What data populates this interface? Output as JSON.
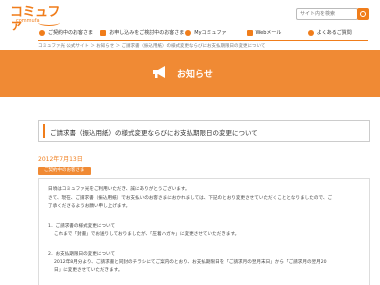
{
  "logo": {
    "name": "コミュファ",
    "tagline": "commufa"
  },
  "search": {
    "placeholder": "サイト内を検索"
  },
  "nav": {
    "items": [
      {
        "label": "ご契約中のお客さま"
      },
      {
        "label": "お申し込みをご検討中のお客さま"
      },
      {
        "label": "Myコミュファ"
      },
      {
        "label": "Webメール"
      },
      {
        "label": "よくあるご質問"
      }
    ]
  },
  "breadcrumb": "コミュファ光 公式サイト ＞ お知らせ ＞ ご請求書（振込用紙）の様式変更ならびにお支払期限日の変更について",
  "banner": {
    "title": "お知らせ",
    "icon": "megaphone-icon"
  },
  "headline": "ご請求書（振込用紙）の様式変更ならびにお支払期限日の変更について",
  "date": "2012年7月13日",
  "category": "ご契約中のお客さま",
  "body": [
    "日頃はコミュファ光をご利用いただき、誠にありがとうございます。",
    "さて、現在、ご請求書（振込用紙）でお支払いのお客さまにおかれましては、下記のとおり変更させていただくこととなりましたので、ご",
    "了承くださるようお願い申し上げます。",
    "1．ご請求書の様式変更について",
    "これまで「封書」でお送りしておりましたが、「圧着ハガキ」に変更させていただきます。",
    "2．お支払期限日の変更について",
    "2012年8月分より、ご請求書と同封のチラシにてご案内のとおり、お支払期限日を「ご請求月の翌月末日」から「ご請求月の翌月20",
    "日」に変更させていただきます。"
  ],
  "colors": {
    "accent": "#f07d1b",
    "banner": "#f08a34"
  }
}
